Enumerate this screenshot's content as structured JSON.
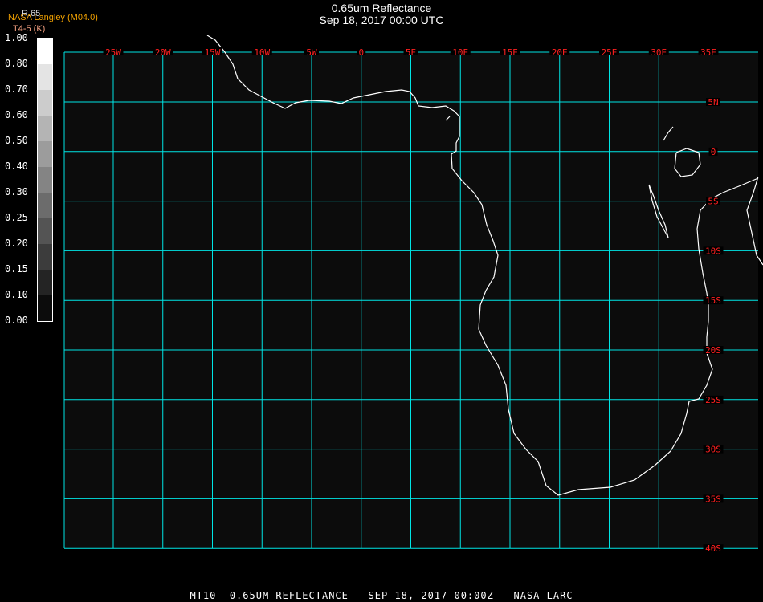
{
  "title": {
    "line1": "0.65um Reflectance",
    "line2": "Sep 18, 2017 00:00 UTC"
  },
  "legend": {
    "organization": "NASA Langley (M04.0)",
    "band": "R.65",
    "unit": "T4-5 (K)",
    "ticks": [
      "1.00",
      "0.80",
      "0.70",
      "0.60",
      "0.50",
      "0.40",
      "0.30",
      "0.25",
      "0.20",
      "0.15",
      "0.10",
      "0.00"
    ],
    "colors": [
      "#ffffff",
      "#e4e4e4",
      "#cccccc",
      "#b4b4b4",
      "#9c9c9c",
      "#848484",
      "#6c6c6c",
      "#545454",
      "#3c3c3c",
      "#242424",
      "#0c0c0c"
    ]
  },
  "map": {
    "grid_color": "#00e5e5",
    "coast_color": "#ffffff",
    "label_color": "#ff2020",
    "background": "#0c0c0c",
    "lon_labels": [
      "25W",
      "20W",
      "15W",
      "10W",
      "5W",
      "0",
      "5E",
      "10E",
      "15E",
      "20E",
      "25E",
      "30E",
      "35E"
    ],
    "lat_labels": [
      "5N",
      "0",
      "5S",
      "10S",
      "15S",
      "20S",
      "25S",
      "30S",
      "35S",
      "40S"
    ]
  },
  "footer": "MT10  0.65UM REFLECTANCE   SEP 18, 2017 00:00Z   NASA LARC"
}
